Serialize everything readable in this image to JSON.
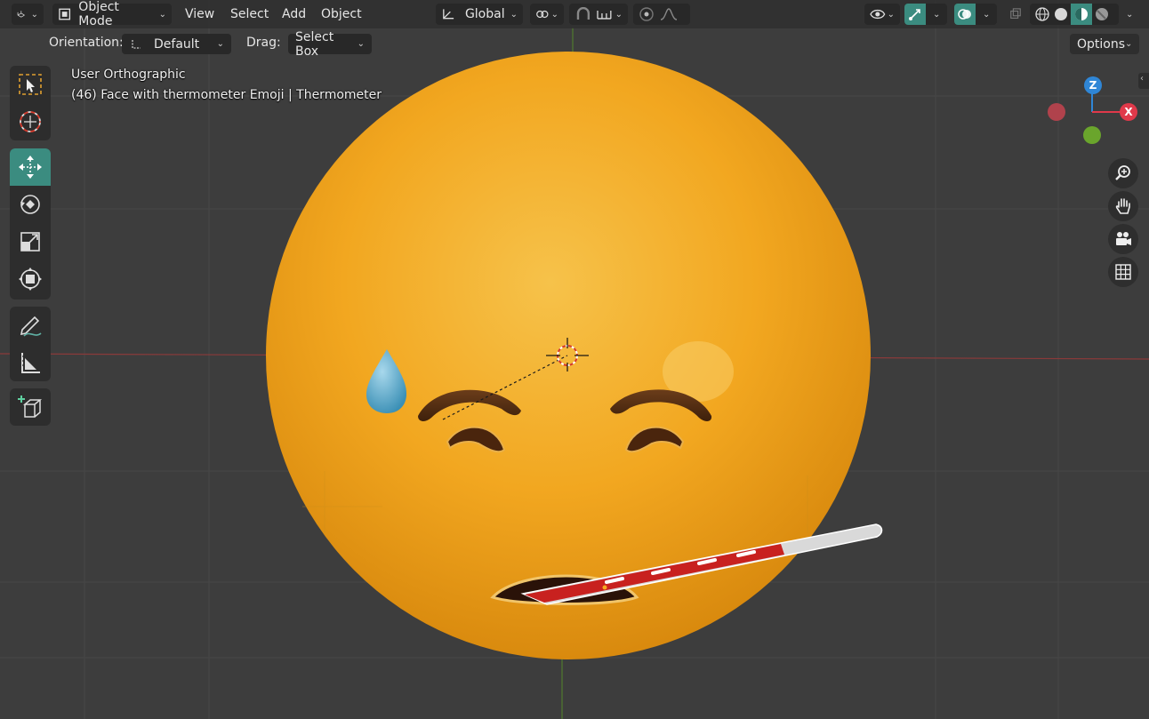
{
  "header": {
    "editor_type": "3d-viewport-icon",
    "mode": "Object Mode",
    "menus": [
      "View",
      "Select",
      "Add",
      "Object"
    ],
    "transform_orientation": "Global"
  },
  "tool_settings": {
    "orientation_label": "Orientation:",
    "orientation_value": "Default",
    "drag_label": "Drag:",
    "drag_value": "Select Box",
    "options_label": "Options"
  },
  "overlay": {
    "view_name": "User Orthographic",
    "object_info": "(46) Face with thermometer Emoji | Thermometer"
  },
  "gizmo": {
    "z": "Z",
    "x": "X"
  },
  "left_toolbar": [
    [
      "select-box-icon",
      "cursor-icon"
    ],
    [
      "move-icon",
      "rotate-icon",
      "scale-icon",
      "transform-icon"
    ],
    [
      "annotate-icon",
      "measure-icon"
    ],
    [
      "add-cube-icon"
    ]
  ],
  "colors": {
    "accent": "#3b8c80",
    "face": "#f3a81c",
    "axis_x": "#e0394a",
    "axis_y": "#6aa52c",
    "axis_z": "#2f86d6"
  }
}
